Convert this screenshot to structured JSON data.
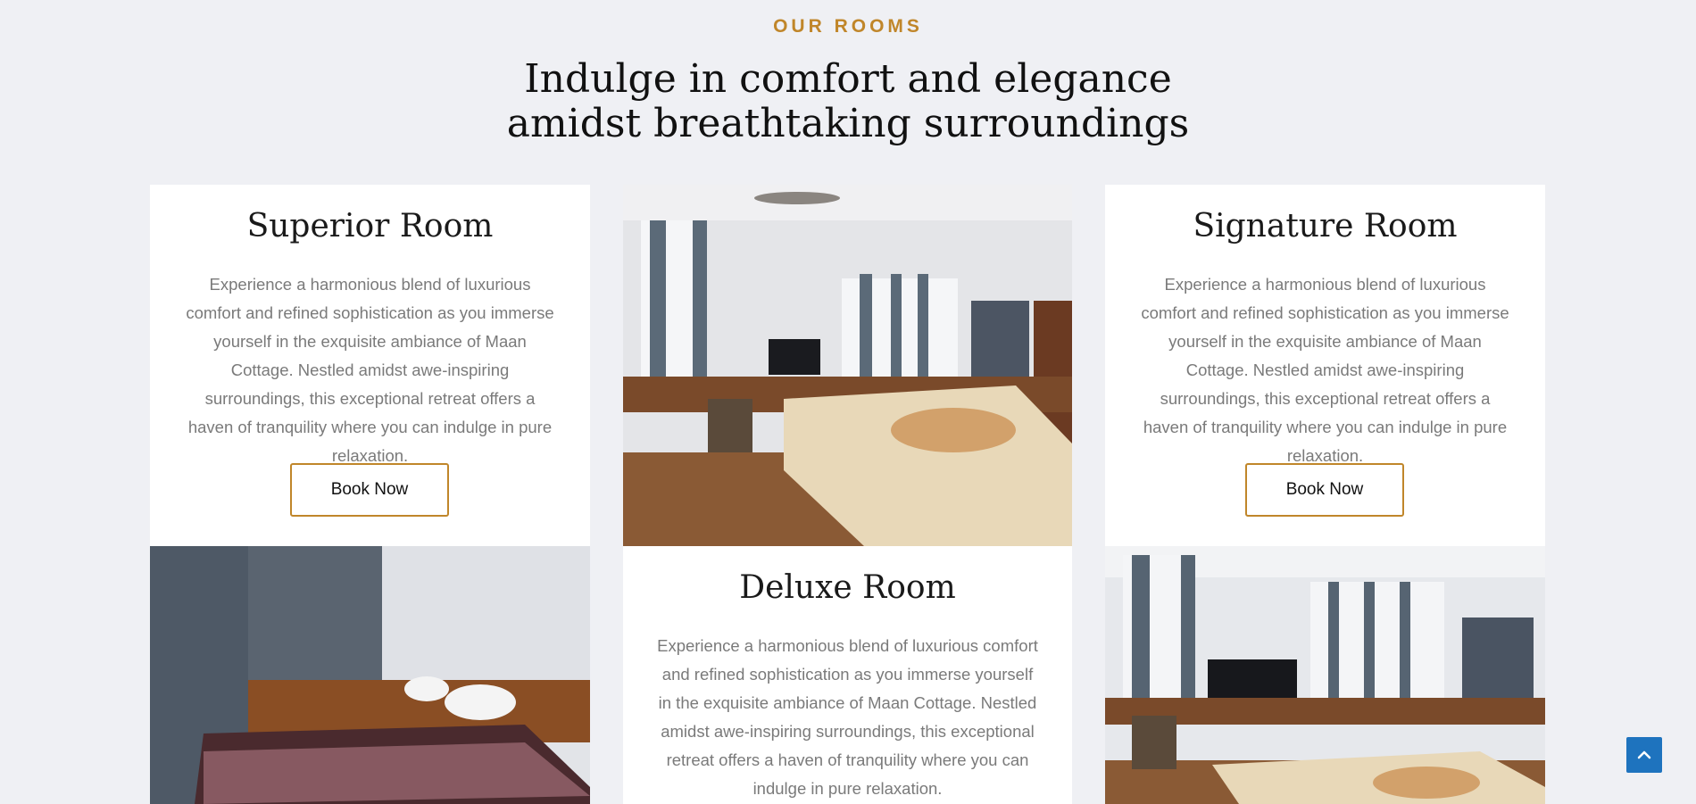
{
  "section": {
    "eyebrow": "OUR ROOMS",
    "heading_line1": "Indulge in comfort and elegance",
    "heading_line2": "amidst breathtaking surroundings"
  },
  "rooms": [
    {
      "title": "Superior Room",
      "description": "Experience a harmonious blend of luxurious comfort and refined sophistication as you immerse yourself in the exquisite ambiance of Maan Cottage. Nestled amidst awe-inspiring surroundings, this exceptional retreat offers a haven of tranquility where you can indulge in pure relaxation.",
      "button": "Book Now"
    },
    {
      "title": "Deluxe Room",
      "description": "Experience a harmonious blend of luxurious comfort and refined sophistication as you immerse yourself in the exquisite ambiance of Maan Cottage. Nestled amidst awe-inspiring surroundings, this exceptional retreat offers a haven of tranquility where you can indulge in pure relaxation."
    },
    {
      "title": "Signature Room",
      "description": "Experience a harmonious blend of luxurious comfort and refined sophistication as you immerse yourself in the exquisite ambiance of Maan Cottage. Nestled amidst awe-inspiring surroundings, this exceptional retreat offers a haven of tranquility where you can indulge in pure relaxation.",
      "button": "Book Now"
    }
  ],
  "scroll_top": {
    "icon": "chevron-up-icon"
  },
  "colors": {
    "accent": "#c0862a",
    "background": "#eff0f4",
    "scroll_top": "#1e73be"
  }
}
